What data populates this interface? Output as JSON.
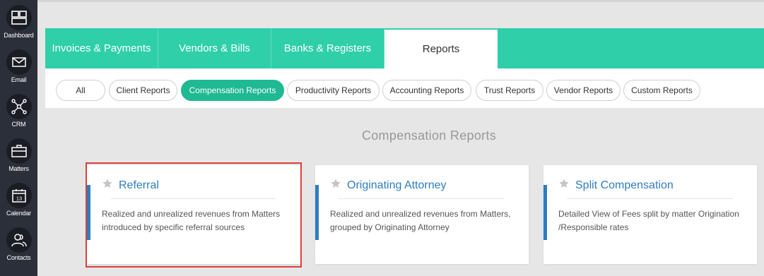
{
  "nav": [
    {
      "label": "Dashboard",
      "icon": "dashboard-icon"
    },
    {
      "label": "Email",
      "icon": "email-icon"
    },
    {
      "label": "CRM",
      "icon": "crm-icon"
    },
    {
      "label": "Matters",
      "icon": "briefcase-icon"
    },
    {
      "label": "Calendar",
      "icon": "calendar-icon",
      "day": "13"
    },
    {
      "label": "Contacts",
      "icon": "contacts-icon"
    }
  ],
  "tabs": [
    {
      "label": "Invoices & Payments"
    },
    {
      "label": "Vendors & Bills"
    },
    {
      "label": "Banks & Registers"
    },
    {
      "label": "Reports",
      "active": true
    }
  ],
  "filters": [
    {
      "label": "All"
    },
    {
      "label": "Client Reports"
    },
    {
      "label": "Compensation Reports",
      "active": true
    },
    {
      "label": "Productivity Reports"
    },
    {
      "label": "Accounting Reports"
    },
    {
      "label": "Trust Reports"
    },
    {
      "label": "Vendor Reports"
    },
    {
      "label": "Custom Reports"
    }
  ],
  "section_title": "Compensation Reports",
  "cards": [
    {
      "title": "Referral",
      "desc_line1": "Realized and unrealized revenues from Matters",
      "desc_line2": "introduced by specific referral sources",
      "selected": true
    },
    {
      "title": "Originating Attorney",
      "desc_line1": "Realized and unrealized revenues from Matters,",
      "desc_line2": "grouped by Originating Attorney"
    },
    {
      "title": "Split Compensation",
      "desc_line1": "Detailed View of Fees split by matter Origination",
      "desc_line2": "/Responsible rates"
    }
  ],
  "colors": {
    "nav_bg": "#2b2f3a",
    "tab_bg": "#2fcfa9",
    "active_pill": "#1fb993",
    "link_blue": "#2f7dbf",
    "highlight_red": "#d9403a"
  }
}
